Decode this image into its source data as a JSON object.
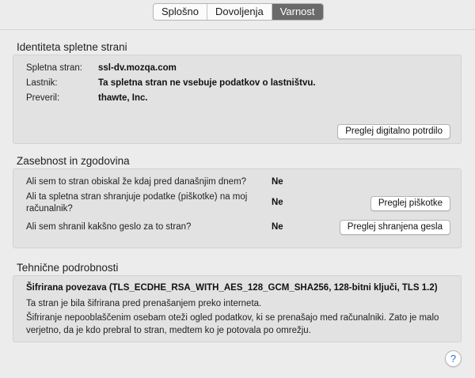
{
  "tabs": [
    "Splošno",
    "Dovoljenja",
    "Varnost"
  ],
  "identity": {
    "title": "Identiteta spletne strani",
    "website_label": "Spletna stran:",
    "website_value": "ssl-dv.mozqa.com",
    "owner_label": "Lastnik:",
    "owner_value": "Ta spletna stran ne vsebuje podatkov o lastništvu.",
    "verifier_label": "Preveril:",
    "verifier_value": "thawte, Inc.",
    "view_cert_button": "Preglej digitalno potrdilo"
  },
  "privacy": {
    "title": "Zasebnost in zgodovina",
    "q1": "Ali sem to stran obiskal že kdaj pred današnjim dnem?",
    "a1": "Ne",
    "q2": "Ali ta spletna stran shranjuje podatke (piškotke) na moj računalnik?",
    "a2": "Ne",
    "cookies_button": "Preglej piškotke",
    "q3": "Ali sem shranil kakšno geslo za to stran?",
    "a3": "Ne",
    "passwords_button": "Preglej shranjena gesla"
  },
  "technical": {
    "title": "Tehnične podrobnosti",
    "encryption_heading": "Šifrirana povezava (TLS_ECDHE_RSA_WITH_AES_128_GCM_SHA256, 128-bitni ključi, TLS 1.2)",
    "line1": "Ta stran je bila šifrirana pred prenašanjem preko interneta.",
    "line2": "Šifriranje nepooblaščenim osebam oteži ogled podatkov, ki se prenašajo med računalniki. Zato je malo verjetno, da je kdo prebral to stran, medtem ko je potovala po omrežju."
  },
  "help_button": "?"
}
